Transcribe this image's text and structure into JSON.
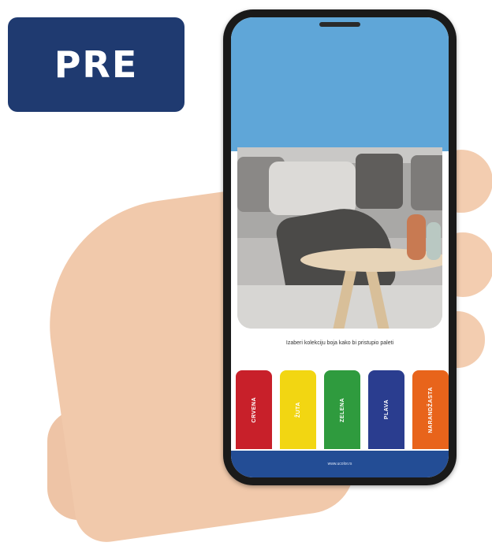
{
  "badge": {
    "label": "PRE"
  },
  "screen": {
    "prompt": "Izaberi kolekciju boja kako bi pristupio paleti",
    "swatches": [
      {
        "label": "CRVENA",
        "color": "#c8202a"
      },
      {
        "label": "ŽUTA",
        "color": "#f2d612"
      },
      {
        "label": "ZELENA",
        "color": "#2f9b3e"
      },
      {
        "label": "PLAVA",
        "color": "#2a3d8f"
      },
      {
        "label": "NARANDŽASTA",
        "color": "#e8641b"
      }
    ],
    "footer_text": "www.ucolor.rs"
  },
  "colors": {
    "badge": "#1f3a70",
    "footer": "#234d95",
    "wall": "#5fa6d8"
  }
}
